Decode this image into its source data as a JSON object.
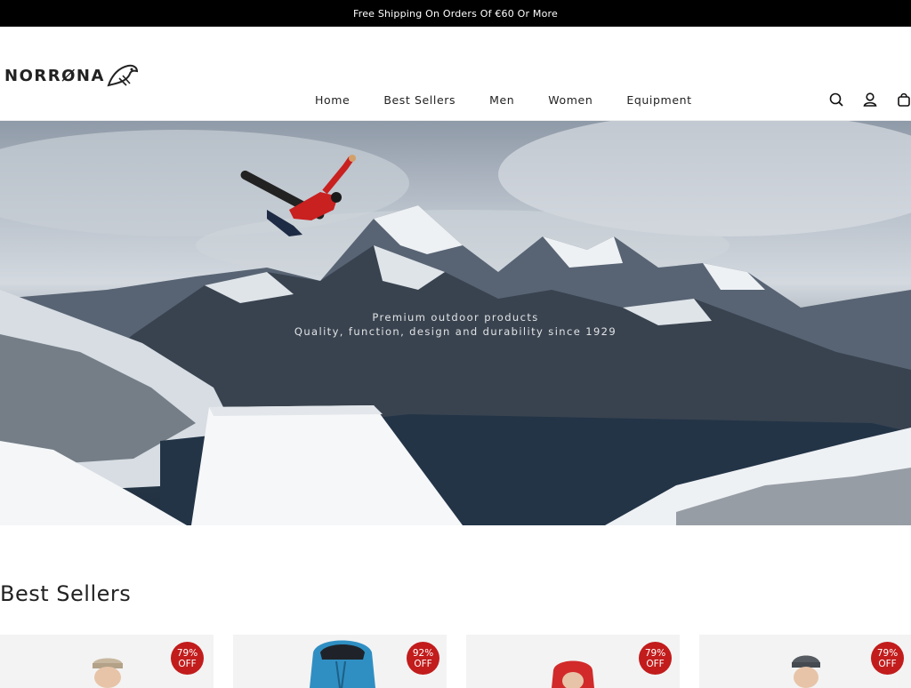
{
  "announcement": "Free Shipping On Orders Of €60 Or More",
  "brand": {
    "name": "NORRØNA",
    "logo_icon": "bird-logo-icon"
  },
  "nav": {
    "items": [
      {
        "label": "Home"
      },
      {
        "label": "Best Sellers"
      },
      {
        "label": "Men"
      },
      {
        "label": "Women"
      },
      {
        "label": "Equipment"
      }
    ]
  },
  "header_icons": [
    "search-icon",
    "account-icon",
    "cart-icon"
  ],
  "hero": {
    "line1": "Premium outdoor products",
    "line2": "Quality, function, design and durability since 1929"
  },
  "best_sellers": {
    "title": "Best Sellers",
    "products": [
      {
        "discount": "79%",
        "off": "OFF",
        "hat_color": "#c8b79f"
      },
      {
        "discount": "92%",
        "off": "OFF",
        "hat_color": "#2f8fc3"
      },
      {
        "discount": "79%",
        "off": "OFF",
        "hat_color": "#d22a2a"
      },
      {
        "discount": "79%",
        "off": "OFF",
        "hat_color": "#555b61"
      }
    ]
  },
  "colors": {
    "announce_bg": "#000000",
    "badge": "#c21c1c"
  }
}
